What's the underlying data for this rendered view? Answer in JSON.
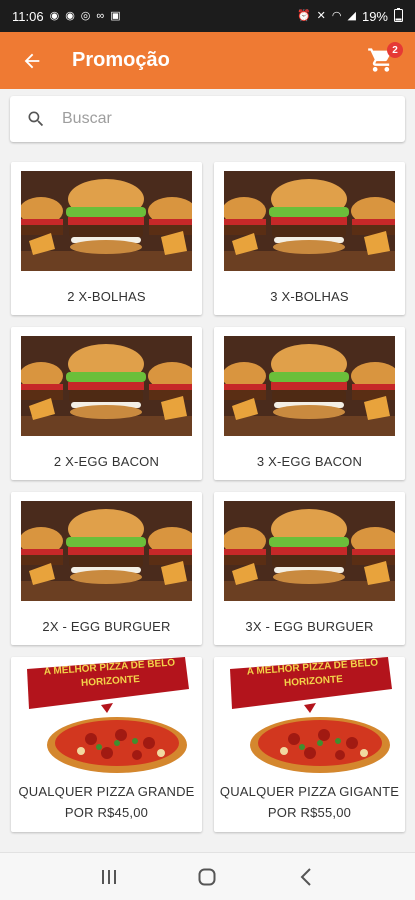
{
  "status_bar": {
    "time": "11:06",
    "battery": "19%"
  },
  "app_bar": {
    "title": "Promoção",
    "cart_count": "2"
  },
  "search": {
    "placeholder": "Buscar"
  },
  "products": [
    {
      "label": "2 X-BOLHAS"
    },
    {
      "label": "3 X-BOLHAS"
    },
    {
      "label": "2 X-EGG BACON"
    },
    {
      "label": "3 X-EGG BACON"
    },
    {
      "label": "2X - EGG BURGUER"
    },
    {
      "label": "3X - EGG BURGUER"
    },
    {
      "label_line1": "QUALQUER PIZZA GRANDE",
      "label_line2": "POR R$45,00",
      "banner": "A MELHOR PIZZA DE BELO HORIZONTE"
    },
    {
      "label_line1": "QUALQUER PIZZA GIGANTE",
      "label_line2": "POR R$55,00",
      "banner": "A MELHOR PIZZA DE BELO HORIZONTE"
    }
  ],
  "colors": {
    "primary": "#ef7a33",
    "badge": "#e53935",
    "banner": "#b3141c"
  },
  "icons": [
    "back-arrow-icon",
    "cart-icon",
    "search-icon",
    "recents-icon",
    "home-icon",
    "back-nav-icon"
  ]
}
